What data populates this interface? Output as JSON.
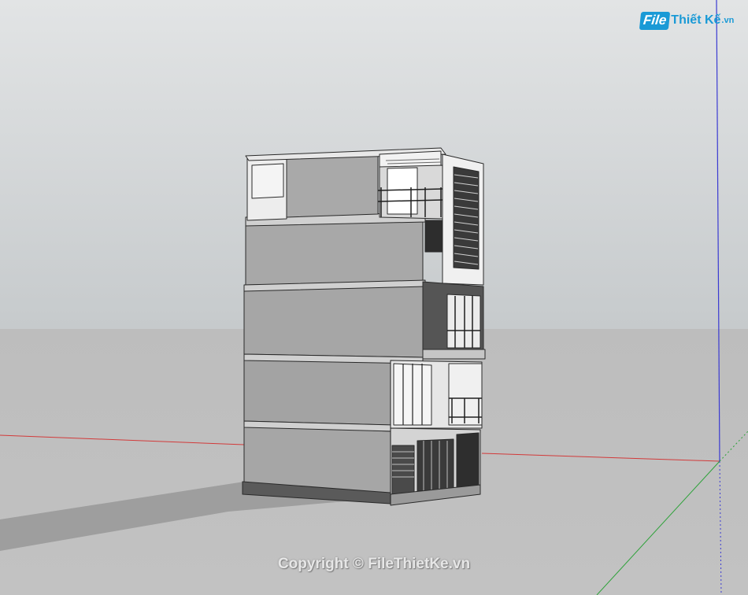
{
  "app": {
    "view": "SketchUp 3D model viewport"
  },
  "logo": {
    "file_part": "File",
    "name_part": "Thiết Kế",
    "ext_part": ".vn"
  },
  "watermark": {
    "text": "Copyright © FileThietKe.vn"
  },
  "colors": {
    "sky_top": "#e2e4e5",
    "ground": "#bdbdbd",
    "axis_red": "#d23a3a",
    "axis_green": "#2ea23a",
    "axis_blue": "#3a3ad2",
    "building_wall": "#a8a8a8",
    "building_side": "#c8c8c8",
    "brand": "#1a9ad6"
  }
}
